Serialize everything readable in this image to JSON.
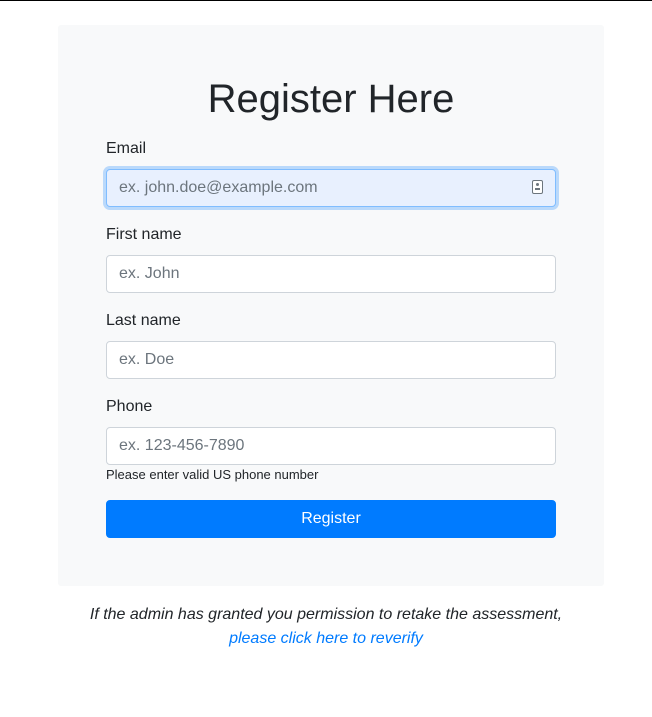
{
  "form": {
    "title": "Register Here",
    "email": {
      "label": "Email",
      "placeholder": "ex. john.doe@example.com",
      "value": ""
    },
    "first_name": {
      "label": "First name",
      "placeholder": "ex. John",
      "value": ""
    },
    "last_name": {
      "label": "Last name",
      "placeholder": "ex. Doe",
      "value": ""
    },
    "phone": {
      "label": "Phone",
      "placeholder": "ex. 123-456-7890",
      "value": "",
      "help": "Please enter valid US phone number"
    },
    "submit_label": "Register"
  },
  "footer": {
    "note": "If the admin has granted you permission to retake the assessment,",
    "link_text": "please click here to reverify"
  },
  "colors": {
    "primary": "#007bff",
    "card_background": "#f8f9fa",
    "focus_ring": "#80bdff"
  }
}
